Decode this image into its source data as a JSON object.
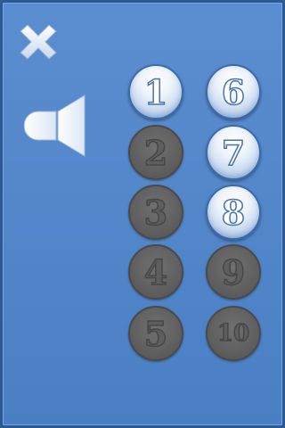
{
  "close": {
    "icon": "close-icon"
  },
  "sound": {
    "icon": "speaker-icon"
  },
  "levels": [
    {
      "label": "1",
      "state": "unlocked"
    },
    {
      "label": "2",
      "state": "locked"
    },
    {
      "label": "3",
      "state": "locked"
    },
    {
      "label": "4",
      "state": "locked"
    },
    {
      "label": "5",
      "state": "locked"
    },
    {
      "label": "6",
      "state": "unlocked"
    },
    {
      "label": "7",
      "state": "unlocked"
    },
    {
      "label": "8",
      "state": "unlocked"
    },
    {
      "label": "9",
      "state": "locked"
    },
    {
      "label": "10",
      "state": "locked"
    }
  ],
  "colors": {
    "background": "#4a7fc4",
    "active": "#ffffff",
    "inactive": "#5f5f5f"
  }
}
